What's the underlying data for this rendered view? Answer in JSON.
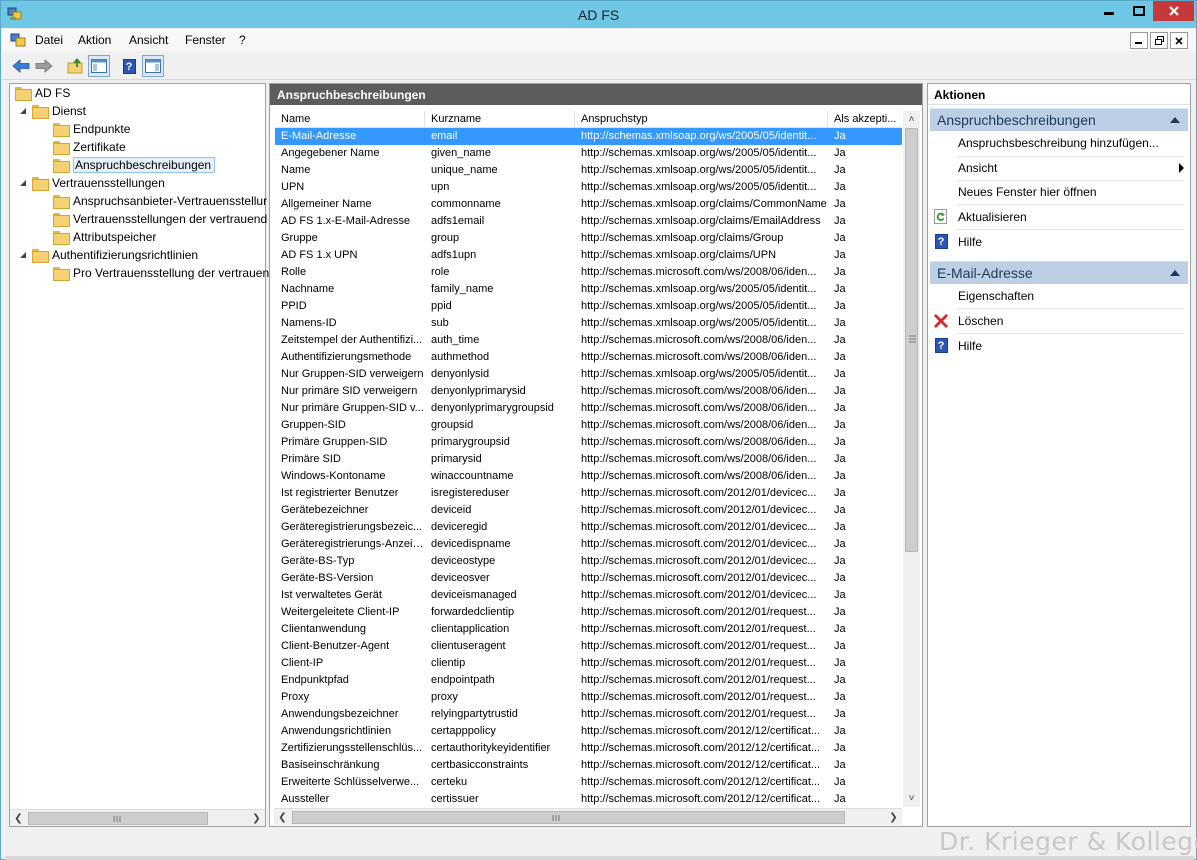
{
  "window": {
    "title": "AD FS"
  },
  "menu": {
    "items": [
      "Datei",
      "Aktion",
      "Ansicht",
      "Fenster",
      "?"
    ]
  },
  "tree": {
    "root": "AD FS",
    "nodes": [
      {
        "label": "Dienst",
        "level": 1,
        "expanded": true
      },
      {
        "label": "Endpunkte",
        "level": 2
      },
      {
        "label": "Zertifikate",
        "level": 2
      },
      {
        "label": "Anspruchbeschreibungen",
        "level": 2,
        "selected": true
      },
      {
        "label": "Vertrauensstellungen",
        "level": 1,
        "expanded": true
      },
      {
        "label": "Anspruchsanbieter-Vertrauensstellur",
        "level": 2
      },
      {
        "label": "Vertrauensstellungen der vertrauend",
        "level": 2
      },
      {
        "label": "Attributspeicher",
        "level": 2
      },
      {
        "label": "Authentifizierungsrichtlinien",
        "level": 1,
        "expanded": true
      },
      {
        "label": "Pro Vertrauensstellung der vertrauen",
        "level": 2
      }
    ]
  },
  "center": {
    "title": "Anspruchbeschreibungen",
    "columns": [
      "Name",
      "Kurzname",
      "Anspruchstyp",
      "Als akzepti..."
    ],
    "rows": [
      [
        "E-Mail-Adresse",
        "email",
        "http://schemas.xmlsoap.org/ws/2005/05/identit...",
        "Ja"
      ],
      [
        "Angegebener Name",
        "given_name",
        "http://schemas.xmlsoap.org/ws/2005/05/identit...",
        "Ja"
      ],
      [
        "Name",
        "unique_name",
        "http://schemas.xmlsoap.org/ws/2005/05/identit...",
        "Ja"
      ],
      [
        "UPN",
        "upn",
        "http://schemas.xmlsoap.org/ws/2005/05/identit...",
        "Ja"
      ],
      [
        "Allgemeiner Name",
        "commonname",
        "http://schemas.xmlsoap.org/claims/CommonName",
        "Ja"
      ],
      [
        "AD FS 1.x-E-Mail-Adresse",
        "adfs1email",
        "http://schemas.xmlsoap.org/claims/EmailAddress",
        "Ja"
      ],
      [
        "Gruppe",
        "group",
        "http://schemas.xmlsoap.org/claims/Group",
        "Ja"
      ],
      [
        "AD FS 1.x UPN",
        "adfs1upn",
        "http://schemas.xmlsoap.org/claims/UPN",
        "Ja"
      ],
      [
        "Rolle",
        "role",
        "http://schemas.microsoft.com/ws/2008/06/iden...",
        "Ja"
      ],
      [
        "Nachname",
        "family_name",
        "http://schemas.xmlsoap.org/ws/2005/05/identit...",
        "Ja"
      ],
      [
        "PPID",
        "ppid",
        "http://schemas.xmlsoap.org/ws/2005/05/identit...",
        "Ja"
      ],
      [
        "Namens-ID",
        "sub",
        "http://schemas.xmlsoap.org/ws/2005/05/identit...",
        "Ja"
      ],
      [
        "Zeitstempel der Authentifizi...",
        "auth_time",
        "http://schemas.microsoft.com/ws/2008/06/iden...",
        "Ja"
      ],
      [
        "Authentifizierungsmethode",
        "authmethod",
        "http://schemas.microsoft.com/ws/2008/06/iden...",
        "Ja"
      ],
      [
        "Nur Gruppen-SID verweigern",
        "denyonlysid",
        "http://schemas.xmlsoap.org/ws/2005/05/identit...",
        "Ja"
      ],
      [
        "Nur primäre SID verweigern",
        "denyonlyprimarysid",
        "http://schemas.microsoft.com/ws/2008/06/iden...",
        "Ja"
      ],
      [
        "Nur primäre Gruppen-SID v...",
        "denyonlyprimarygroupsid",
        "http://schemas.microsoft.com/ws/2008/06/iden...",
        "Ja"
      ],
      [
        "Gruppen-SID",
        "groupsid",
        "http://schemas.microsoft.com/ws/2008/06/iden...",
        "Ja"
      ],
      [
        "Primäre Gruppen-SID",
        "primarygroupsid",
        "http://schemas.microsoft.com/ws/2008/06/iden...",
        "Ja"
      ],
      [
        "Primäre SID",
        "primarysid",
        "http://schemas.microsoft.com/ws/2008/06/iden...",
        "Ja"
      ],
      [
        "Windows-Kontoname",
        "winaccountname",
        "http://schemas.microsoft.com/ws/2008/06/iden...",
        "Ja"
      ],
      [
        "Ist registrierter Benutzer",
        "isregistereduser",
        "http://schemas.microsoft.com/2012/01/devicec...",
        "Ja"
      ],
      [
        "Gerätebezeichner",
        "deviceid",
        "http://schemas.microsoft.com/2012/01/devicec...",
        "Ja"
      ],
      [
        "Geräteregistrierungsbezeic...",
        "deviceregid",
        "http://schemas.microsoft.com/2012/01/devicec...",
        "Ja"
      ],
      [
        "Geräteregistrierungs-Anzeig...",
        "devicedispname",
        "http://schemas.microsoft.com/2012/01/devicec...",
        "Ja"
      ],
      [
        "Geräte-BS-Typ",
        "deviceostype",
        "http://schemas.microsoft.com/2012/01/devicec...",
        "Ja"
      ],
      [
        "Geräte-BS-Version",
        "deviceosver",
        "http://schemas.microsoft.com/2012/01/devicec...",
        "Ja"
      ],
      [
        "Ist verwaltetes Gerät",
        "deviceismanaged",
        "http://schemas.microsoft.com/2012/01/devicec...",
        "Ja"
      ],
      [
        "Weitergeleitete Client-IP",
        "forwardedclientip",
        "http://schemas.microsoft.com/2012/01/request...",
        "Ja"
      ],
      [
        "Clientanwendung",
        "clientapplication",
        "http://schemas.microsoft.com/2012/01/request...",
        "Ja"
      ],
      [
        "Client-Benutzer-Agent",
        "clientuseragent",
        "http://schemas.microsoft.com/2012/01/request...",
        "Ja"
      ],
      [
        "Client-IP",
        "clientip",
        "http://schemas.microsoft.com/2012/01/request...",
        "Ja"
      ],
      [
        "Endpunktpfad",
        "endpointpath",
        "http://schemas.microsoft.com/2012/01/request...",
        "Ja"
      ],
      [
        "Proxy",
        "proxy",
        "http://schemas.microsoft.com/2012/01/request...",
        "Ja"
      ],
      [
        "Anwendungsbezeichner",
        "relyingpartytrustid",
        "http://schemas.microsoft.com/2012/01/request...",
        "Ja"
      ],
      [
        "Anwendungsrichtlinien",
        "certapppolicy",
        "http://schemas.microsoft.com/2012/12/certificat...",
        "Ja"
      ],
      [
        "Zertifizierungsstellenschlüs...",
        "certauthoritykeyidentifier",
        "http://schemas.microsoft.com/2012/12/certificat...",
        "Ja"
      ],
      [
        "Basiseinschränkung",
        "certbasicconstraints",
        "http://schemas.microsoft.com/2012/12/certificat...",
        "Ja"
      ],
      [
        "Erweiterte Schlüsselverwe...",
        "certeku",
        "http://schemas.microsoft.com/2012/12/certificat...",
        "Ja"
      ],
      [
        "Aussteller",
        "certissuer",
        "http://schemas.microsoft.com/2012/12/certificat...",
        "Ja"
      ]
    ]
  },
  "actions": {
    "title": "Aktionen",
    "section1": {
      "title": "Anspruchbeschreibungen",
      "items": [
        {
          "label": "Anspruchsbeschreibung hinzufügen...",
          "icon": "none"
        },
        {
          "label": "Ansicht",
          "icon": "none",
          "submenu": true
        },
        {
          "label": "Neues Fenster hier öffnen",
          "icon": "none"
        },
        {
          "label": "Aktualisieren",
          "icon": "refresh-icon"
        },
        {
          "label": "Hilfe",
          "icon": "help-icon"
        }
      ]
    },
    "section2": {
      "title": "E-Mail-Adresse",
      "items": [
        {
          "label": "Eigenschaften",
          "icon": "none"
        },
        {
          "label": "Löschen",
          "icon": "delete-icon"
        },
        {
          "label": "Hilfe",
          "icon": "help-icon"
        }
      ]
    }
  },
  "watermark": "Dr. Krieger & Kollegen",
  "colors": {
    "titlebar": "#6ec7e4",
    "selection": "#3399ff",
    "section_header": "#bccfe5",
    "center_header": "#5c5c5c",
    "close_button": "#c7383a"
  }
}
